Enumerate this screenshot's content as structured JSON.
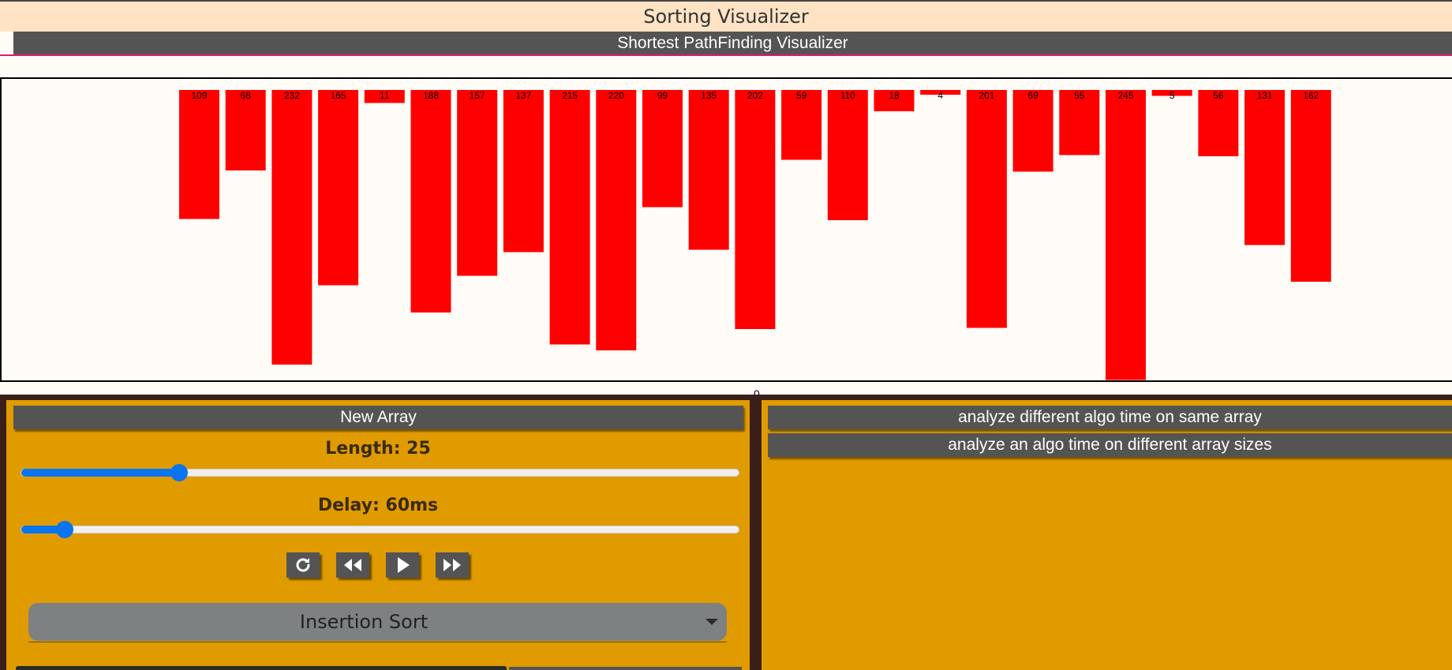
{
  "header": {
    "title": "Sorting Visualizer",
    "nav_button": "Shortest PathFinding Visualizer"
  },
  "chart_data": {
    "type": "bar",
    "values": [
      109,
      68,
      232,
      165,
      11,
      188,
      157,
      137,
      215,
      220,
      99,
      135,
      202,
      59,
      110,
      18,
      4,
      201,
      69,
      55,
      245,
      5,
      56,
      131,
      162
    ],
    "bar_color": "#ff0000",
    "orientation": "top-down",
    "value_labels": true
  },
  "status_glyph": "0",
  "controls": {
    "new_array_label": "New Array",
    "length_label": "Length: 25",
    "length_fraction": 0.22,
    "delay_label": "Delay: 60ms",
    "delay_fraction": 0.06,
    "playback": {
      "reset_icon": "reset-icon",
      "rewind_icon": "rewind-icon",
      "play_icon": "play-icon",
      "fast_forward_icon": "fast-forward-icon"
    },
    "algorithm_select": "Insertion Sort"
  },
  "analysis": {
    "same_array_label": "analyze different algo time on same array",
    "array_sizes_label": "analyze an algo time on different array sizes"
  },
  "colors": {
    "panel": "#e09b00",
    "button": "#545454",
    "accent": "#0b74ef",
    "bar": "#ff0000"
  }
}
